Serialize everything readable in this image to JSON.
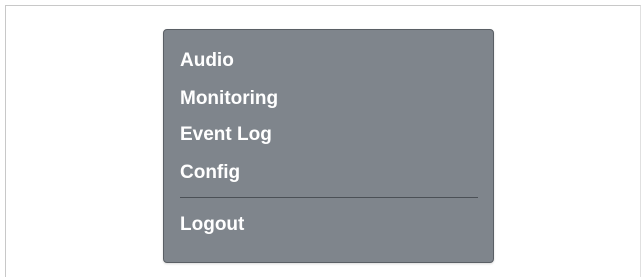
{
  "menu": {
    "items": [
      {
        "label": "Audio"
      },
      {
        "label": "Monitoring"
      },
      {
        "label": "Event Log"
      },
      {
        "label": "Config"
      }
    ],
    "logout_label": "Logout"
  },
  "colors": {
    "menu_background": "#7f858c",
    "menu_text": "#ffffff",
    "divider": "#4b5056"
  }
}
